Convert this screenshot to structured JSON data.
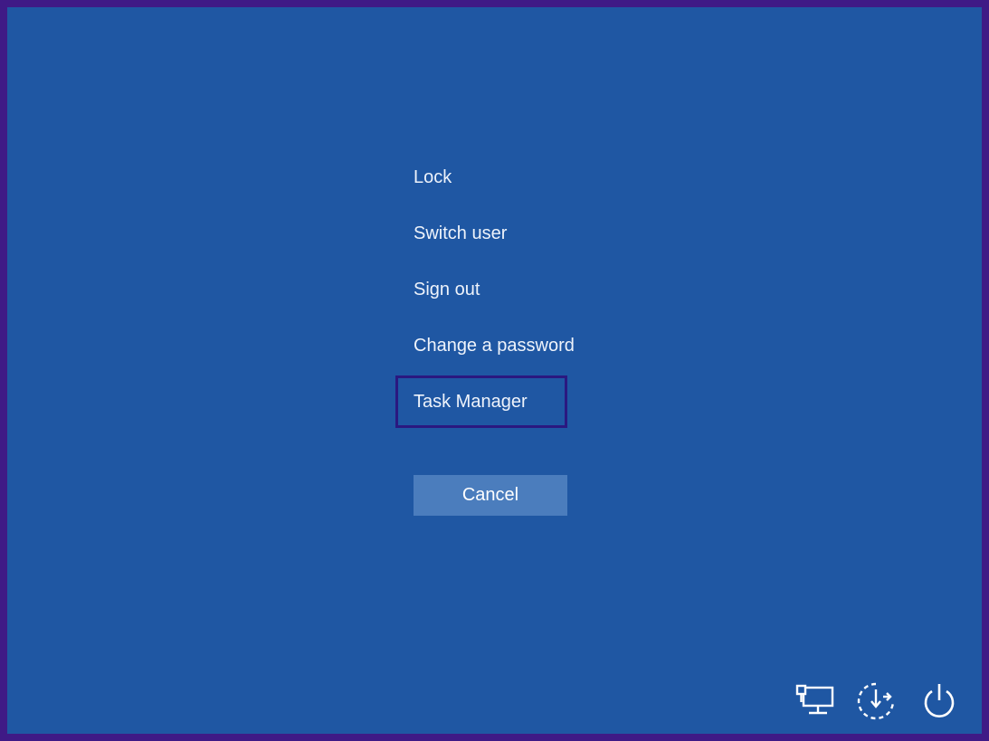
{
  "menu": {
    "items": [
      {
        "label": "Lock"
      },
      {
        "label": "Switch user"
      },
      {
        "label": "Sign out"
      },
      {
        "label": "Change a password"
      },
      {
        "label": "Task Manager",
        "highlighted": true
      }
    ]
  },
  "cancel_label": "Cancel",
  "tray": {
    "icons": [
      "network-icon",
      "ease-of-access-icon",
      "power-icon"
    ]
  },
  "colors": {
    "background": "#1f57a3",
    "border": "#3f1a86",
    "highlight_outline": "#2a1880",
    "button": "#4b7dbd",
    "text": "#eef3fb"
  }
}
